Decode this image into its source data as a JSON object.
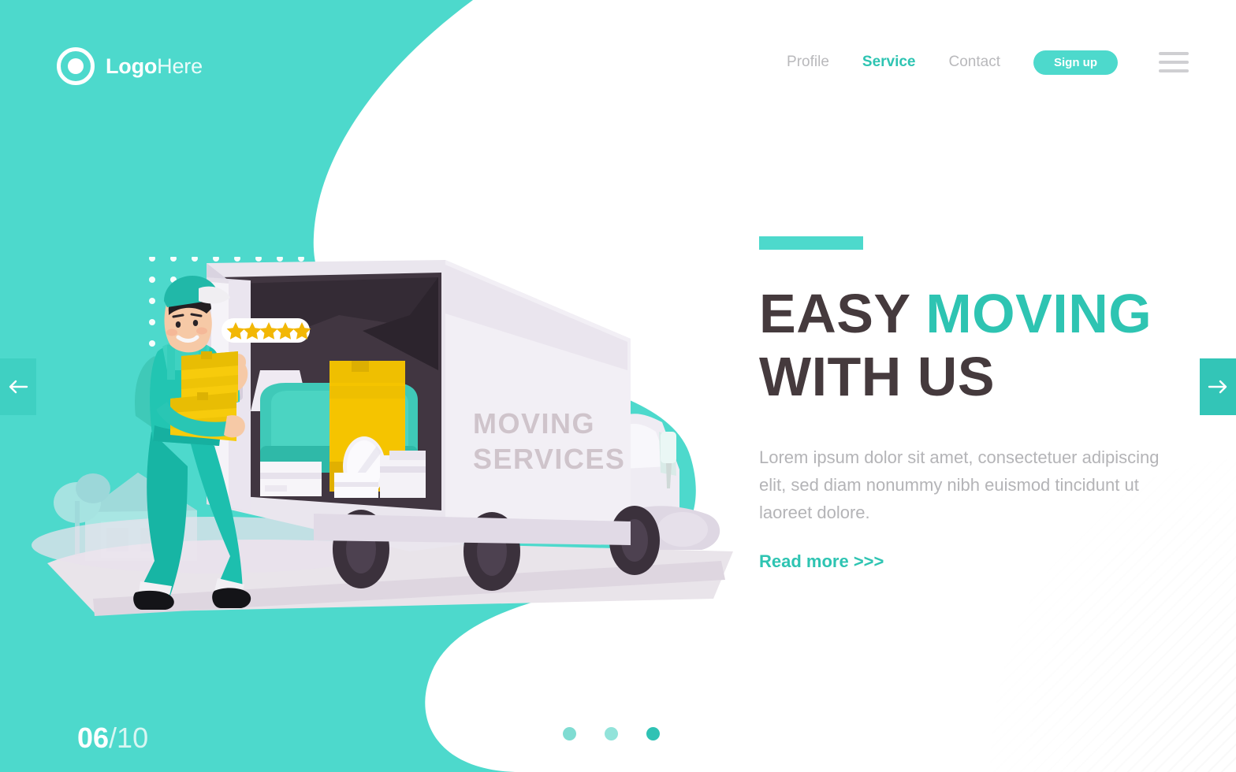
{
  "brand": {
    "accent": "#4dd9cc",
    "accent_dark": "#2ec4b2",
    "headline_color": "#453a3d",
    "body_color": "#b4b4b7",
    "background": "#4dd9cc",
    "panel": "#ffffff"
  },
  "header": {
    "logo_bold": "Logo",
    "logo_light": "Here",
    "logo_icon": "circle-ring-icon",
    "nav": [
      {
        "label": "Profile",
        "active": false
      },
      {
        "label": "Service",
        "active": true
      },
      {
        "label": "Contact",
        "active": false
      }
    ],
    "signup_label": "Sign up",
    "menu_icon": "hamburger-menu-icon"
  },
  "hero": {
    "accent_bar": true,
    "headline_line1_part1": "EASY ",
    "headline_line1_part2": "MOVING",
    "headline_line2": "WITH US",
    "body": "Lorem ipsum dolor sit amet, consectetuer adipiscing elit, sed diam nonummy nibh euismod tincidunt ut laoreet dolore.",
    "read_more": "Read more >>>"
  },
  "slider": {
    "current": "06",
    "total": "/10",
    "prev_icon": "arrow-left-icon",
    "next_icon": "arrow-right-icon",
    "dots": 3,
    "active_dot": 3
  },
  "illustration": {
    "truck_label_line1": "MOVING",
    "truck_label_line2": "SERVICES",
    "rating_stars": 5,
    "star_glyph": "★",
    "alt": "mover carrying cardboard boxes beside an open moving truck filled with furniture"
  }
}
